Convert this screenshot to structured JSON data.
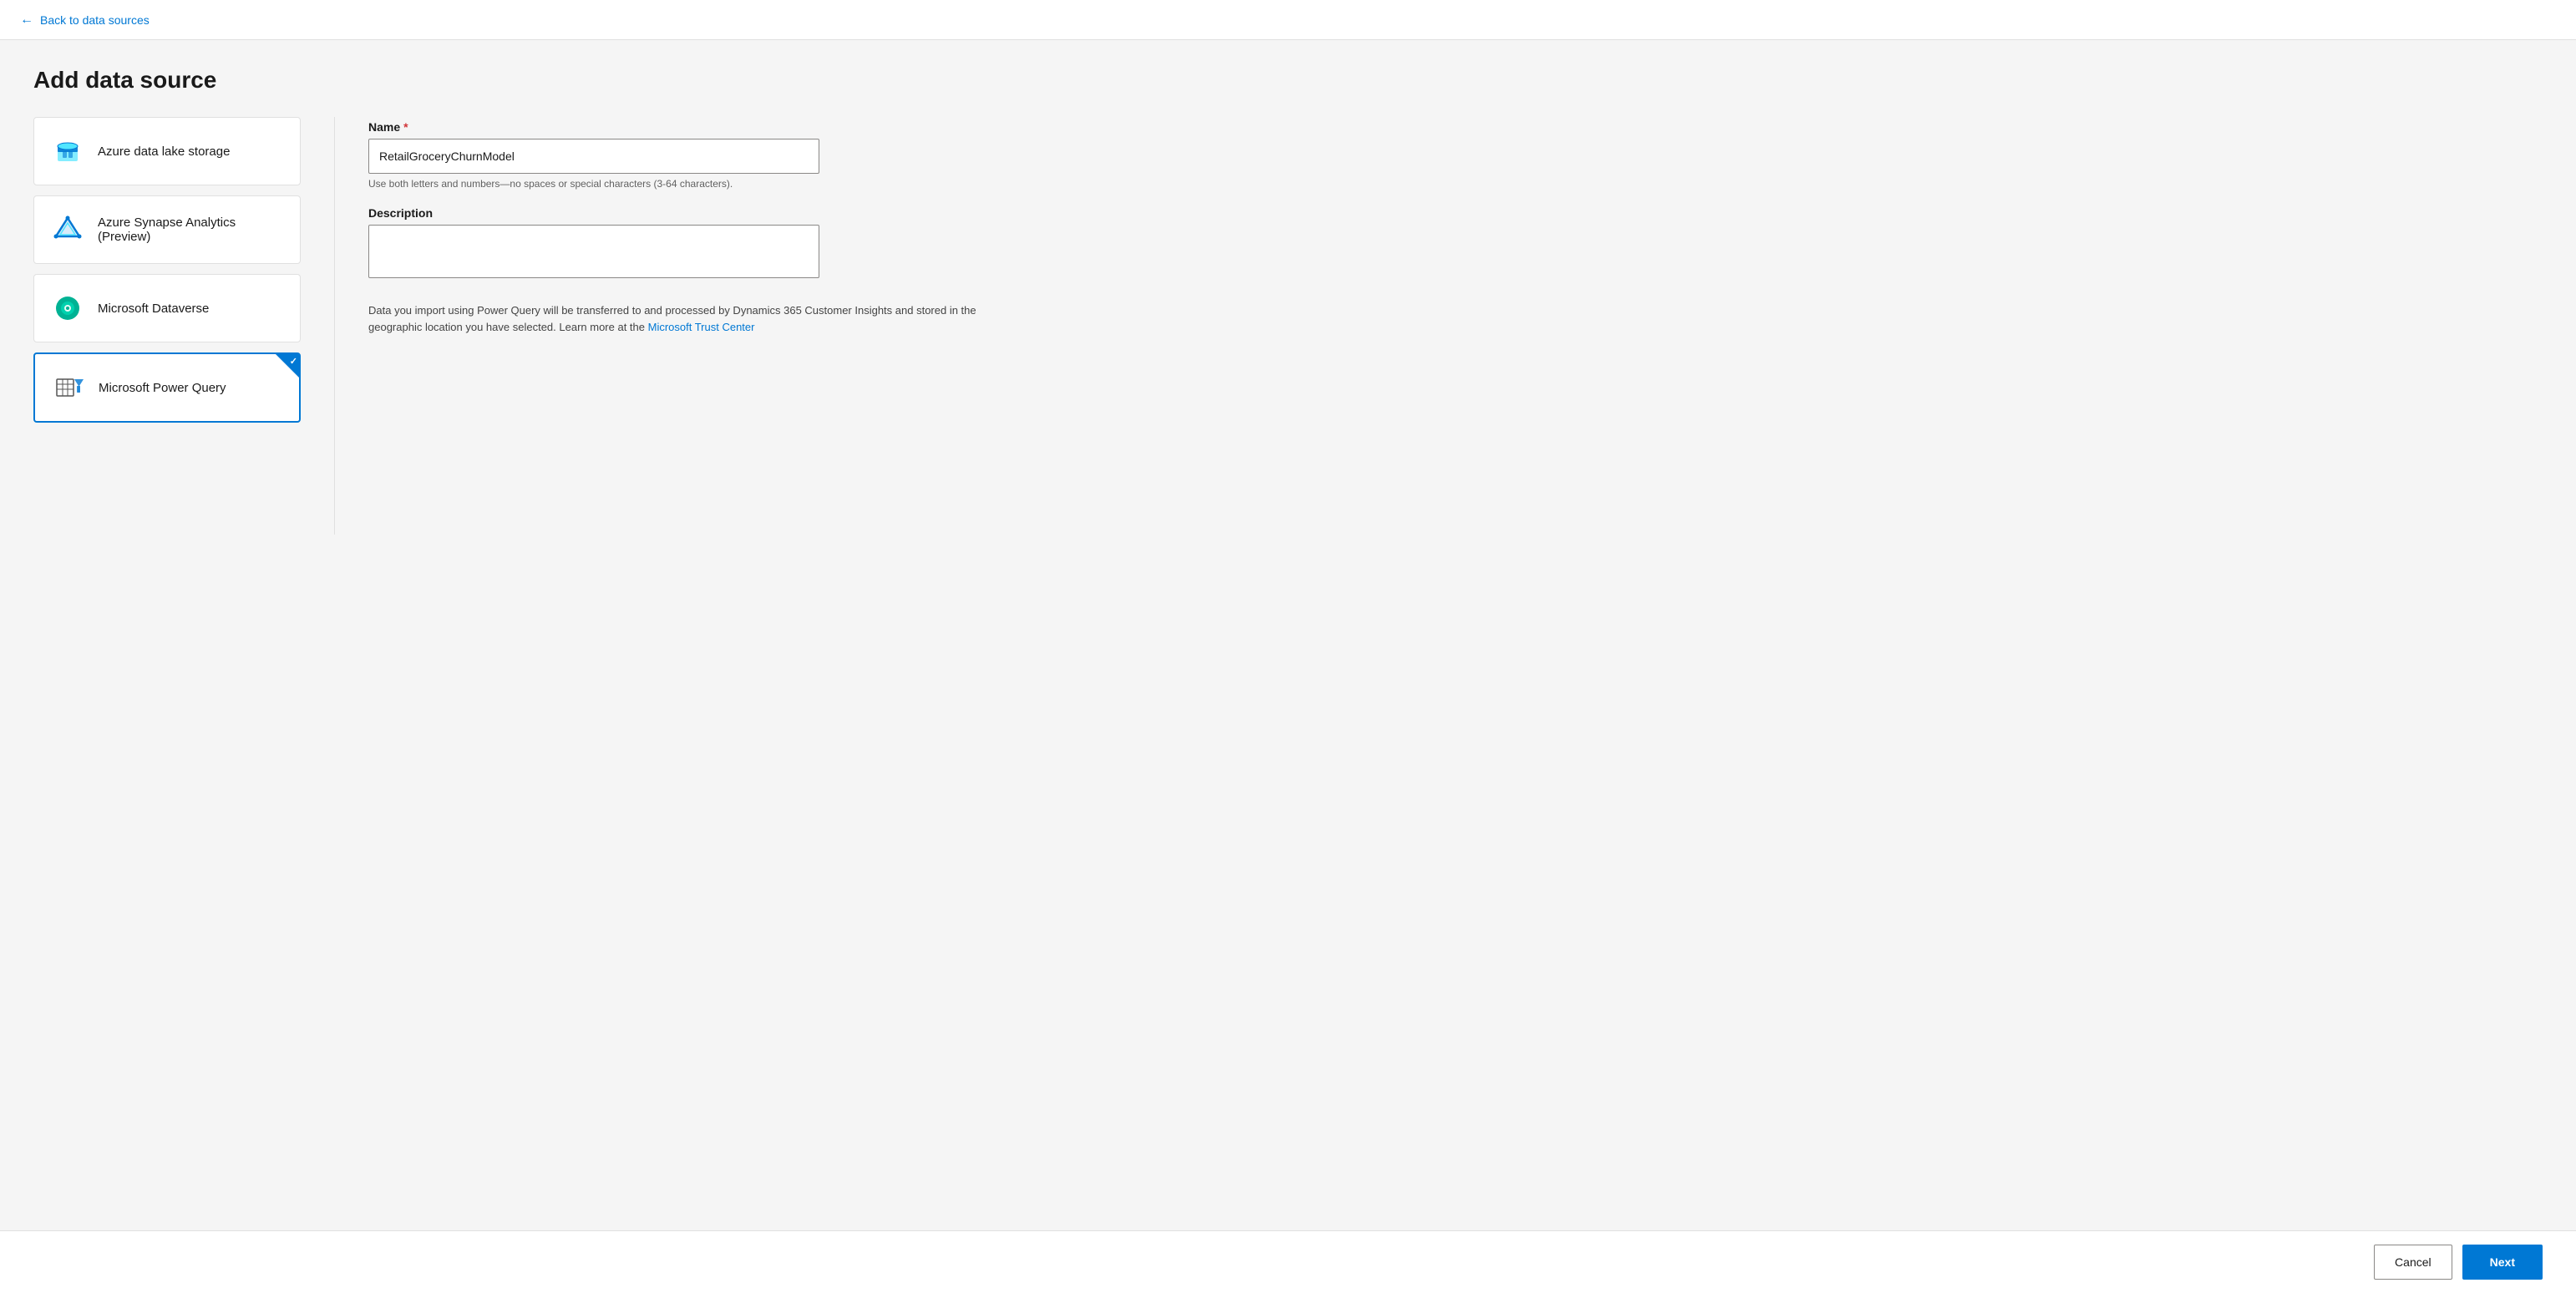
{
  "nav": {
    "back_label": "Back to data sources"
  },
  "page": {
    "title": "Add data source"
  },
  "sources": [
    {
      "id": "azure-lake",
      "label": "Azure data lake storage",
      "selected": false,
      "icon": "azure-lake-icon"
    },
    {
      "id": "synapse",
      "label": "Azure Synapse Analytics (Preview)",
      "selected": false,
      "icon": "synapse-icon"
    },
    {
      "id": "dataverse",
      "label": "Microsoft Dataverse",
      "selected": false,
      "icon": "dataverse-icon"
    },
    {
      "id": "powerquery",
      "label": "Microsoft Power Query",
      "selected": true,
      "icon": "powerquery-icon"
    }
  ],
  "form": {
    "name_label": "Name",
    "name_required": true,
    "name_value": "RetailGroceryChurnModel",
    "name_hint": "Use both letters and numbers—no spaces or special characters (3-64 characters).",
    "description_label": "Description",
    "description_value": "",
    "description_placeholder": "",
    "info_text_part1": "Data you import using Power Query will be transferred to and processed by Dynamics 365 Customer Insights and stored in the geographic location you have selected. Learn more at the ",
    "info_link_label": "Microsoft Trust Center",
    "info_link_url": "#"
  },
  "footer": {
    "cancel_label": "Cancel",
    "next_label": "Next"
  }
}
